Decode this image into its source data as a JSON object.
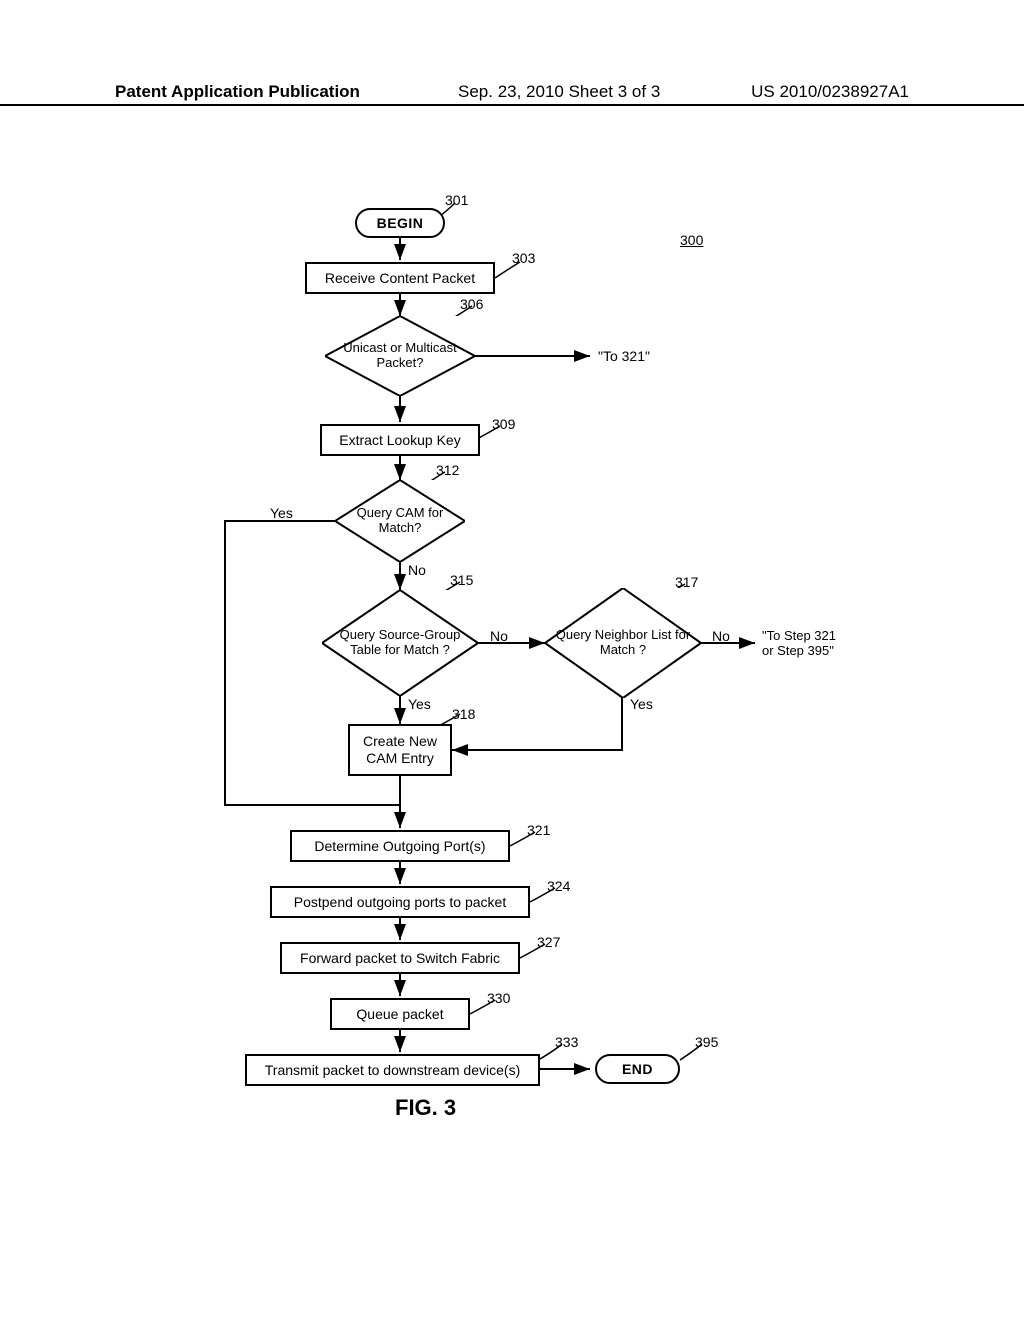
{
  "header": {
    "left": "Patent Application Publication",
    "mid": "Sep. 23, 2010  Sheet 3 of 3",
    "right": "US 2010/0238927A1"
  },
  "pageRef": "300",
  "nodes": {
    "n301": {
      "text": "BEGIN",
      "ref": "301"
    },
    "n303": {
      "text": "Receive Content Packet",
      "ref": "303"
    },
    "n306": {
      "text": "Unicast\nor Multicast\nPacket?",
      "ref": "306",
      "rightLabel": "\"To 321\""
    },
    "n309": {
      "text": "Extract Lookup Key",
      "ref": "309"
    },
    "n312": {
      "text": "Query\nCAM for\nMatch?",
      "ref": "312",
      "leftLabel": "Yes",
      "bottomLabel": "No"
    },
    "n315": {
      "text": "Query\nSource-Group\nTable for\nMatch ?",
      "ref": "315",
      "rightLabel": "No",
      "bottomLabel": "Yes"
    },
    "n317": {
      "text": "Query\nNeighbor List\nfor Match\n?",
      "ref": "317",
      "rightLabel": "No",
      "rightText": "\"To Step 321\nor Step 395\"",
      "bottomLabel": "Yes"
    },
    "n318": {
      "text": "Create New\nCAM Entry",
      "ref": "318"
    },
    "n321": {
      "text": "Determine Outgoing Port(s)",
      "ref": "321"
    },
    "n324": {
      "text": "Postpend outgoing ports to packet",
      "ref": "324"
    },
    "n327": {
      "text": "Forward packet to Switch Fabric",
      "ref": "327"
    },
    "n330": {
      "text": "Queue packet",
      "ref": "330"
    },
    "n333": {
      "text": "Transmit packet to downstream device(s)",
      "ref": "333"
    },
    "n395": {
      "text": "END",
      "ref": "395"
    }
  },
  "figCaption": "FIG. 3"
}
